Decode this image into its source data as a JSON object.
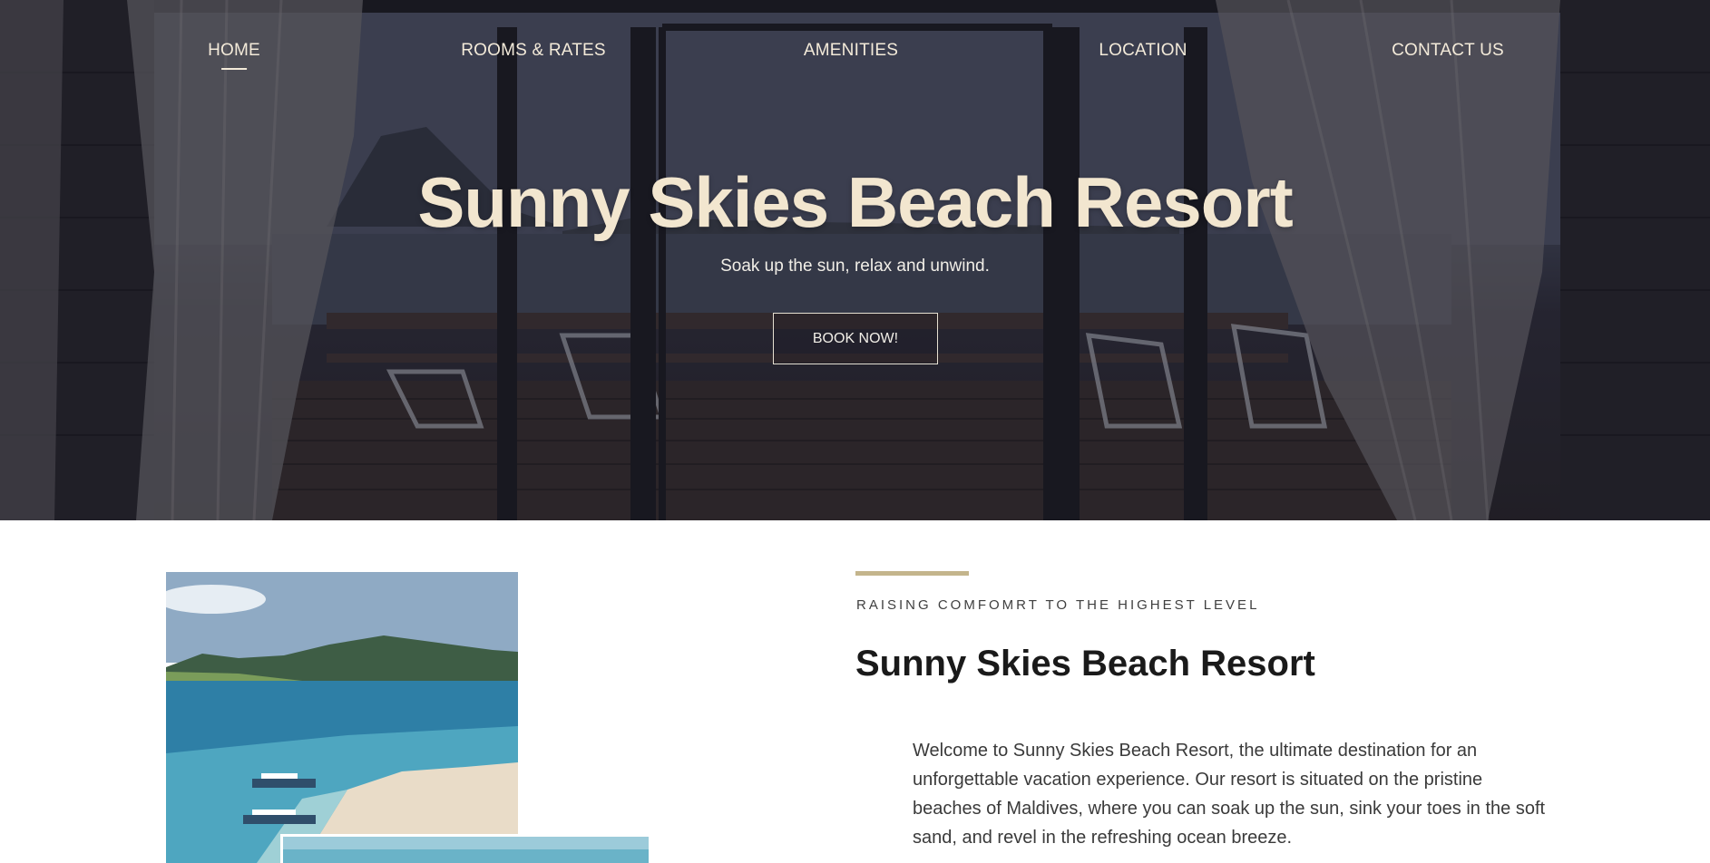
{
  "nav": {
    "items": [
      {
        "label": "HOME",
        "active": true
      },
      {
        "label": "ROOMS & RATES",
        "active": false
      },
      {
        "label": "AMENITIES",
        "active": false
      },
      {
        "label": "LOCATION",
        "active": false
      },
      {
        "label": "CONTACT US",
        "active": false
      }
    ]
  },
  "hero": {
    "title": "Sunny Skies Beach Resort",
    "subtitle": "Soak up the sun, relax and unwind.",
    "cta_label": "BOOK NOW!"
  },
  "about": {
    "eyebrow": "RAISING COMFOMRT TO THE HIGHEST LEVEL",
    "title": "Sunny Skies Beach Resort",
    "body": "Welcome to Sunny Skies Beach Resort, the ultimate destination for an unforgettable vacation experience. Our resort is situated on the pristine beaches of Maldives, where you can soak up the sun, sink your toes in the soft sand, and revel in the refreshing ocean breeze."
  },
  "colors": {
    "accent": "#c4b58c",
    "hero_title": "#f2e6cf",
    "nav_text": "#f3ead9"
  }
}
